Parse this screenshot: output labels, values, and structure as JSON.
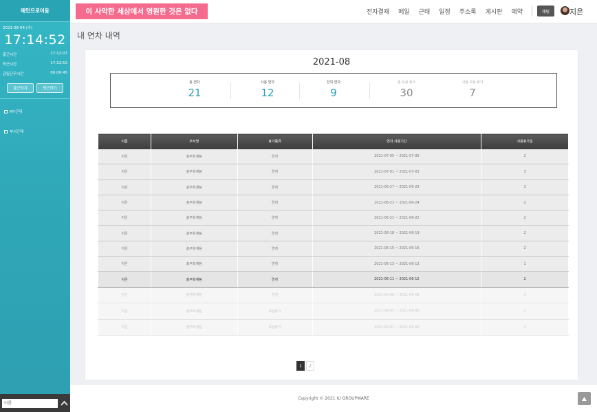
{
  "sidebar": {
    "brand": "메인으로이동",
    "date": "2021-08-04 (수)",
    "clock": "17:14:52",
    "rows": [
      {
        "label": "출근시간",
        "value": "17:12:07"
      },
      {
        "label": "퇴근시간",
        "value": "17:12:52"
      },
      {
        "label": "금일근무시간",
        "value": "00:00:45"
      }
    ],
    "checkin_label": "출근하기",
    "checkout_label": "퇴근하기",
    "menu": [
      "MY근태",
      "부서근태"
    ],
    "search_placeholder": "이름"
  },
  "header": {
    "motto": "이 사악한 세상에서 영원한 것은 없다",
    "nav": [
      "전자결재",
      "메일",
      "근태",
      "일정",
      "주소록",
      "게시판",
      "예약"
    ],
    "chat_label": "채팅",
    "user_name": "지은"
  },
  "page_title": "내 연차 내역",
  "summary": {
    "month": "2021-08",
    "stats": [
      {
        "label": "총 연차",
        "value": "21"
      },
      {
        "label": "사용 연차",
        "value": "12"
      },
      {
        "label": "잔여 연차",
        "value": "9"
      },
      {
        "label": "총 보상 휴가",
        "value": "30"
      },
      {
        "label": "사용 보상 휴가",
        "value": "7"
      }
    ]
  },
  "table": {
    "columns": [
      "이름",
      "부서명",
      "휴가종류",
      "연차 사용기간",
      "사용휴가일"
    ],
    "rows": [
      [
        "지은",
        "총무회계팀",
        "연차",
        "2021-07-05 ~ 2021-07-06",
        "2"
      ],
      [
        "지은",
        "총무회계팀",
        "연차",
        "2021-07-01 ~ 2021-07-03",
        "3"
      ],
      [
        "지은",
        "총무회계팀",
        "연차",
        "2021-06-27 ~ 2021-06-29",
        "3"
      ],
      [
        "지은",
        "총무회계팀",
        "연차",
        "2021-06-23 ~ 2021-06-24",
        "2"
      ],
      [
        "지은",
        "총무회계팀",
        "연차",
        "2021-06-21 ~ 2021-06-22",
        "2"
      ],
      [
        "지은",
        "총무회계팀",
        "연차",
        "2021-06-18 ~ 2021-06-19",
        "2"
      ],
      [
        "지은",
        "총무회계팀",
        "연차",
        "2021-06-15 ~ 2021-06-16",
        "2"
      ],
      [
        "지은",
        "총무회계팀",
        "연차",
        "2021-06-13 ~ 2021-06-13",
        "1"
      ],
      [
        "지은",
        "총무회계팀",
        "연차",
        "2021-06-11 ~ 2021-06-12",
        "2"
      ],
      [
        "지은",
        "총무회계팀",
        "연차",
        "2021-06-08 ~ 2021-06-09",
        "2"
      ],
      [
        "지은",
        "총무회계팀",
        "보상휴가",
        "2021-06-05 ~ 2021-06-06",
        "2"
      ],
      [
        "지은",
        "총무회계팀",
        "보상휴가",
        "2021-06-01 ~ 2021-06-02",
        "2"
      ]
    ]
  },
  "pagination": [
    "1",
    "2"
  ],
  "footer": {
    "copyright": "Copyright © 2021 IU GROUPWARE"
  }
}
